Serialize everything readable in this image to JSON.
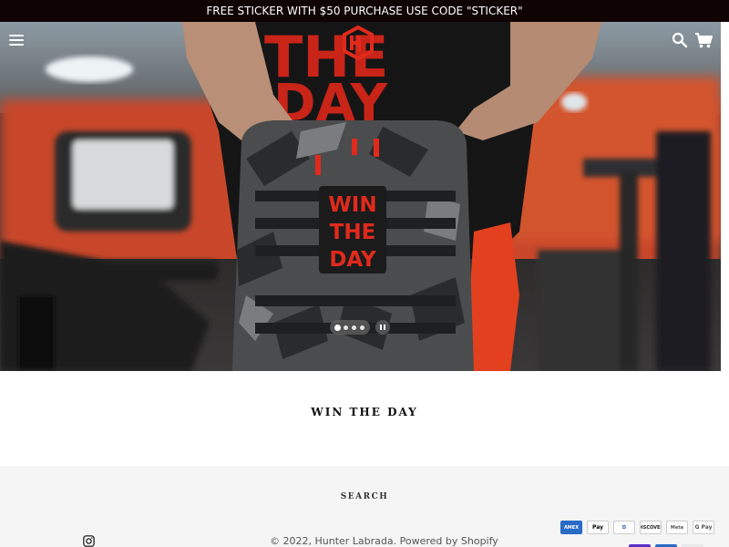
{
  "announcement": {
    "text": "FREE STICKER WITH $50 PURCHASE USE CODE \"STICKER\""
  },
  "hero": {
    "patch_lines": [
      "WIN",
      "THE",
      "DAY"
    ],
    "slider": {
      "slide_count": 4,
      "active_slide": 1
    }
  },
  "section": {
    "title": "WIN THE DAY"
  },
  "footer": {
    "search_label": "SEARCH",
    "copyright_prefix": "© 2022, ",
    "brand_link": "Hunter Labrada",
    "powered_link": "Powered by Shopify",
    "payments": [
      "AMEX",
      "Pay",
      "D",
      "DISCOVER",
      "Meta",
      "G Pay"
    ]
  },
  "colors": {
    "accent": "#e02a1b",
    "announcement_bg": "#0f0304",
    "footer_bg": "#f5f5f5"
  }
}
